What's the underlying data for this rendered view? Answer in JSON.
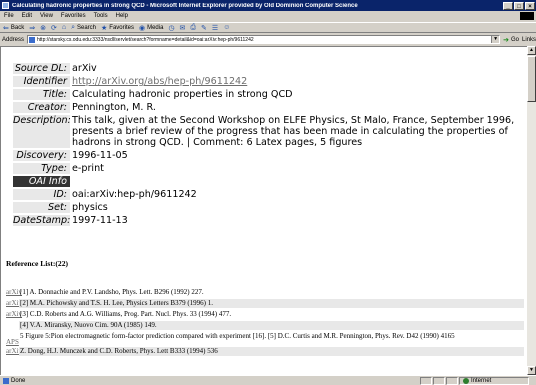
{
  "window": {
    "title": "Calculating hadronic properties in strong QCD - Microsoft Internet Explorer provided by Old Dominion Computer Science",
    "controls": [
      "_",
      "□",
      "×"
    ]
  },
  "menu": [
    "File",
    "Edit",
    "View",
    "Favorites",
    "Tools",
    "Help"
  ],
  "toolbar": {
    "back": "Back",
    "search": "Search",
    "favorites": "Favorites",
    "media": "Media"
  },
  "address": {
    "label": "Address",
    "url": "http://starsky.cs.odu.edu:3333/nsdl/servlet/search?formname=detail&id=oai:arXiv:hep-ph/9611242",
    "go": "Go",
    "links": "Links"
  },
  "record": {
    "source_dl": {
      "label": "Source DL:",
      "value": "arXiv"
    },
    "identifier": {
      "label": "Identifier",
      "value": "http://arXiv.org/abs/hep-ph/9611242"
    },
    "title": {
      "label": "Title:",
      "value": "Calculating hadronic properties in strong QCD"
    },
    "creator": {
      "label": "Creator:",
      "value": "Pennington, M. R."
    },
    "description": {
      "label": "Description:",
      "value": "This talk, given at the Second Workshop on ELFE Physics, St Malo, France, September 1996, presents a brief review of the progress that has been made in calculating the properties of hadrons in strong QCD. | Comment: 6 Latex pages, 5 figures"
    },
    "discovery": {
      "label": "Discovery:",
      "value": "1996-11-05"
    },
    "type": {
      "label": "Type:",
      "value": "e-print"
    },
    "oai_info": {
      "label": "OAI Info"
    },
    "id": {
      "label": "ID:",
      "value": "oai:arXiv:hep-ph/9611242"
    },
    "set": {
      "label": "Set:",
      "value": "physics"
    },
    "datestamp": {
      "label": "DateStamp:",
      "value": "1997-11-13"
    }
  },
  "reference_list": {
    "heading": "Reference List:(22)",
    "items": [
      {
        "source": "arXiv",
        "text": "[1] A. Donnachie and P.V. Landsho, Phys. Lett. B296 (1992) 227."
      },
      {
        "source": "arXiv",
        "text": "[2] M.A. Pichowsky and T.S. H. Lee, Physics Letters B379 (1996) 1."
      },
      {
        "source": "arXiv",
        "text": "[3] C.D. Roberts and A.G. Williams, Prog. Part. Nucl. Phys. 33 (1994) 477."
      },
      {
        "source": "",
        "text": "[4] V.A. Miransky, Nuovo Cim. 90A (1985) 149."
      },
      {
        "source": "APS",
        "text": "5 Figure 5:Pion electromagnetic form-factor prediction compared with experiment [16]. [5] D.C. Curtis and M.R. Pennington, Phys. Rev. D42 (1990) 4165"
      },
      {
        "source": "arXiv",
        "text": "Z. Dong, H.J. Munczek and C.D. Roberts, Phys. Lett B333 (1994) 536"
      }
    ]
  },
  "status": {
    "text": "Done",
    "zone": "Internet"
  }
}
